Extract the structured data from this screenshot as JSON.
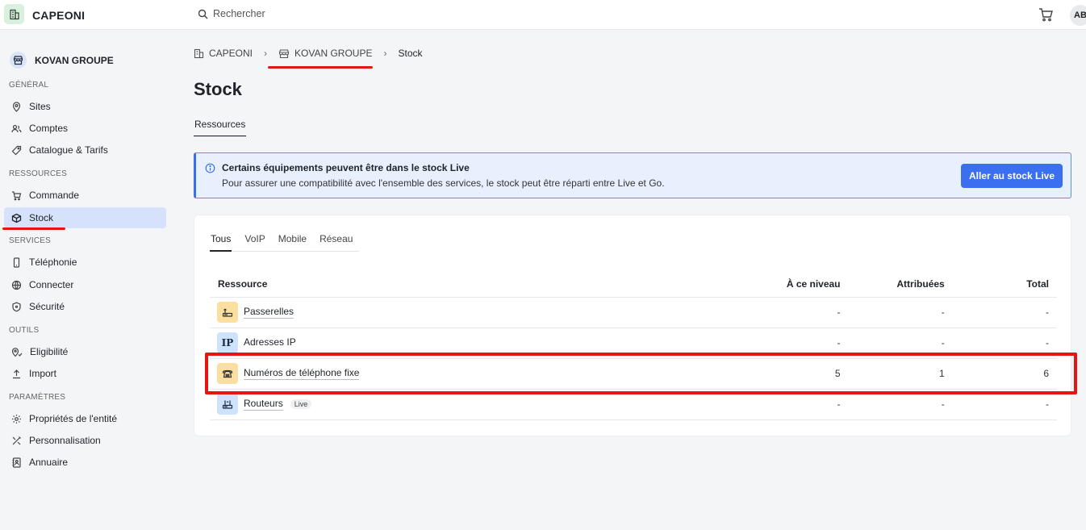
{
  "header": {
    "app_title": "CAPEONI",
    "search_placeholder": "Rechercher",
    "avatar_initials": "AB"
  },
  "sidebar": {
    "org_name": "KOVAN GROUPE",
    "sections": {
      "general": "GÉNÉRAL",
      "ressources": "RESSOURCES",
      "services": "SERVICES",
      "outils": "OUTILS",
      "parametres": "PARAMÈTRES"
    },
    "items": {
      "sites": "Sites",
      "comptes": "Comptes",
      "catalogue": "Catalogue & Tarifs",
      "commande": "Commande",
      "stock": "Stock",
      "telephonie": "Téléphonie",
      "connecter": "Connecter",
      "securite": "Sécurité",
      "eligibilite": "Eligibilité",
      "import": "Import",
      "proprietes": "Propriétés de l'entité",
      "personnalisation": "Personnalisation",
      "annuaire": "Annuaire"
    },
    "active_item": "Stock"
  },
  "breadcrumb": {
    "root": "CAPEONI",
    "org": "KOVAN GROUPE",
    "current": "Stock"
  },
  "page": {
    "title": "Stock",
    "tab": "Ressources"
  },
  "alert": {
    "title": "Certains équipements peuvent être dans le stock Live",
    "text": "Pour assurer une compatibilité avec l'ensemble des services, le stock peut être réparti entre Live et Go.",
    "button": "Aller au stock Live"
  },
  "filters": {
    "tabs": [
      "Tous",
      "VoIP",
      "Mobile",
      "Réseau"
    ],
    "active": "Tous"
  },
  "table": {
    "headers": {
      "resource": "Ressource",
      "level": "À ce niveau",
      "assigned": "Attribuées",
      "total": "Total"
    },
    "rows": [
      {
        "name": "Passerelles",
        "icon_text": "",
        "level": "-",
        "assigned": "-",
        "total": "-",
        "badge": ""
      },
      {
        "name": "Adresses IP",
        "icon_text": "IP",
        "level": "-",
        "assigned": "-",
        "total": "-",
        "badge": ""
      },
      {
        "name": "Numéros de téléphone fixe",
        "icon_text": "",
        "level": "5",
        "assigned": "1",
        "total": "6",
        "badge": ""
      },
      {
        "name": "Routeurs",
        "icon_text": "",
        "level": "-",
        "assigned": "-",
        "total": "-",
        "badge": "Live"
      }
    ]
  },
  "colors": {
    "accent": "#3a6ff0",
    "active_nav": "#d6e2fb",
    "annotation_red": "#e31515",
    "alert_bg": "#e8f0fd"
  }
}
